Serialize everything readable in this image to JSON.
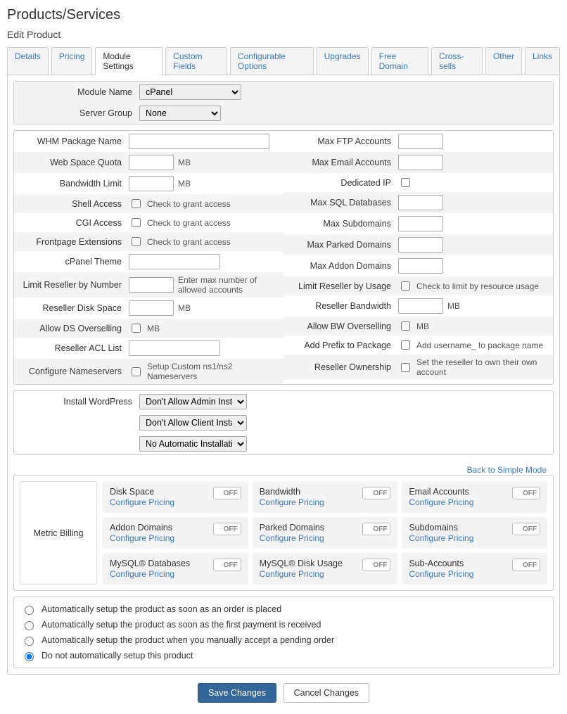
{
  "page": {
    "title": "Products/Services",
    "subtitle": "Edit Product"
  },
  "tabs": {
    "details": "Details",
    "pricing": "Pricing",
    "module_settings": "Module Settings",
    "custom_fields": "Custom Fields",
    "configurable_options": "Configurable Options",
    "upgrades": "Upgrades",
    "free_domain": "Free Domain",
    "cross_sells": "Cross-sells",
    "other": "Other",
    "links": "Links"
  },
  "module": {
    "module_name_label": "Module Name",
    "module_name_value": "cPanel",
    "server_group_label": "Server Group",
    "server_group_value": "None"
  },
  "settings": {
    "left": {
      "whm_package_name": {
        "label": "WHM Package Name",
        "value": ""
      },
      "web_space_quota": {
        "label": "Web Space Quota",
        "value": "",
        "suffix": "MB"
      },
      "bandwidth_limit": {
        "label": "Bandwidth Limit",
        "value": "",
        "suffix": "MB"
      },
      "shell_access": {
        "label": "Shell Access",
        "hint": "Check to grant access"
      },
      "cgi_access": {
        "label": "CGI Access",
        "hint": "Check to grant access"
      },
      "frontpage_ext": {
        "label": "Frontpage Extensions",
        "hint": "Check to grant access"
      },
      "cpanel_theme": {
        "label": "cPanel Theme",
        "value": ""
      },
      "limit_reseller_number": {
        "label": "Limit Reseller by Number",
        "value": "",
        "hint": "Enter max number of allowed accounts"
      },
      "reseller_disk_space": {
        "label": "Reseller Disk Space",
        "value": "",
        "suffix": "MB"
      },
      "allow_ds_oversell": {
        "label": "Allow DS Overselling",
        "hint": "MB"
      },
      "reseller_acl_list": {
        "label": "Reseller ACL List",
        "value": ""
      },
      "configure_nameservers": {
        "label": "Configure Nameservers",
        "hint": "Setup Custom ns1/ns2 Nameservers"
      }
    },
    "right": {
      "max_ftp": {
        "label": "Max FTP Accounts",
        "value": ""
      },
      "max_email": {
        "label": "Max Email Accounts",
        "value": ""
      },
      "dedicated_ip": {
        "label": "Dedicated IP"
      },
      "max_sql": {
        "label": "Max SQL Databases",
        "value": ""
      },
      "max_subdomains": {
        "label": "Max Subdomains",
        "value": ""
      },
      "max_parked": {
        "label": "Max Parked Domains",
        "value": ""
      },
      "max_addon": {
        "label": "Max Addon Domains",
        "value": ""
      },
      "limit_reseller_usage": {
        "label": "Limit Reseller by Usage",
        "hint": "Check to limit by resource usage"
      },
      "reseller_bandwidth": {
        "label": "Reseller Bandwidth",
        "value": "",
        "suffix": "MB"
      },
      "allow_bw_oversell": {
        "label": "Allow BW Overselling",
        "hint": "MB"
      },
      "add_prefix": {
        "label": "Add Prefix to Package",
        "hint": "Add username_ to package name"
      },
      "reseller_ownership": {
        "label": "Reseller Ownership",
        "hint": "Set the reseller to own their own account"
      }
    }
  },
  "wordpress": {
    "label": "Install WordPress",
    "admin": "Don't Allow Admin Installation",
    "client": "Don't Allow Client Installation",
    "auto": "No Automatic Installations"
  },
  "back_link": "Back to Simple Mode",
  "metric": {
    "label": "Metric Billing",
    "configure": "Configure Pricing",
    "off": "OFF",
    "items": {
      "disk_space": "Disk Space",
      "bandwidth": "Bandwidth",
      "email_accounts": "Email Accounts",
      "addon_domains": "Addon Domains",
      "parked_domains": "Parked Domains",
      "subdomains": "Subdomains",
      "mysql_db": "MySQL® Databases",
      "mysql_disk": "MySQL® Disk Usage",
      "sub_accounts": "Sub-Accounts"
    }
  },
  "autosetup": {
    "order": "Automatically setup the product as soon as an order is placed",
    "payment": "Automatically setup the product as soon as the first payment is received",
    "manual_accept": "Automatically setup the product when you manually accept a pending order",
    "none": "Do not automatically setup this product"
  },
  "buttons": {
    "save": "Save Changes",
    "cancel": "Cancel Changes"
  }
}
